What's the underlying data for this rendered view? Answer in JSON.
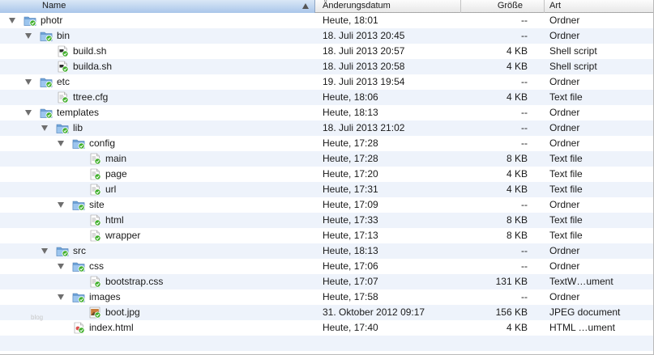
{
  "columns": {
    "name": "Name",
    "date": "Änderungsdatum",
    "size": "Größe",
    "kind": "Art"
  },
  "watermark": "blog",
  "rows": [
    {
      "name": "photr",
      "date": "Heute, 18:01",
      "size": "--",
      "kind": "Ordner",
      "type": "folder",
      "depth": 0,
      "icon": "folder-icon"
    },
    {
      "name": "bin",
      "date": "18. Juli 2013 20:45",
      "size": "--",
      "kind": "Ordner",
      "type": "folder",
      "depth": 1,
      "icon": "folder-icon"
    },
    {
      "name": "build.sh",
      "date": "18. Juli 2013 20:57",
      "size": "4 KB",
      "kind": "Shell script",
      "type": "script",
      "depth": 2,
      "icon": "shell-script-icon"
    },
    {
      "name": "builda.sh",
      "date": "18. Juli 2013 20:58",
      "size": "4 KB",
      "kind": "Shell script",
      "type": "script",
      "depth": 2,
      "icon": "shell-script-icon"
    },
    {
      "name": "etc",
      "date": "19. Juli 2013 19:54",
      "size": "--",
      "kind": "Ordner",
      "type": "folder",
      "depth": 1,
      "icon": "folder-icon"
    },
    {
      "name": "ttree.cfg",
      "date": "Heute, 18:06",
      "size": "4 KB",
      "kind": "Text file",
      "type": "text",
      "depth": 2,
      "icon": "text-file-icon"
    },
    {
      "name": "templates",
      "date": "Heute, 18:13",
      "size": "--",
      "kind": "Ordner",
      "type": "folder",
      "depth": 1,
      "icon": "folder-icon"
    },
    {
      "name": "lib",
      "date": "18. Juli 2013 21:02",
      "size": "--",
      "kind": "Ordner",
      "type": "folder",
      "depth": 2,
      "icon": "folder-icon"
    },
    {
      "name": "config",
      "date": "Heute, 17:28",
      "size": "--",
      "kind": "Ordner",
      "type": "folder",
      "depth": 3,
      "icon": "folder-icon"
    },
    {
      "name": "main",
      "date": "Heute, 17:28",
      "size": "8 KB",
      "kind": "Text file",
      "type": "text",
      "depth": 4,
      "icon": "text-file-icon"
    },
    {
      "name": "page",
      "date": "Heute, 17:20",
      "size": "4 KB",
      "kind": "Text file",
      "type": "text",
      "depth": 4,
      "icon": "text-file-icon"
    },
    {
      "name": "url",
      "date": "Heute, 17:31",
      "size": "4 KB",
      "kind": "Text file",
      "type": "text",
      "depth": 4,
      "icon": "text-file-icon"
    },
    {
      "name": "site",
      "date": "Heute, 17:09",
      "size": "--",
      "kind": "Ordner",
      "type": "folder",
      "depth": 3,
      "icon": "folder-icon"
    },
    {
      "name": "html",
      "date": "Heute, 17:33",
      "size": "8 KB",
      "kind": "Text file",
      "type": "text",
      "depth": 4,
      "icon": "text-file-icon"
    },
    {
      "name": "wrapper",
      "date": "Heute, 17:13",
      "size": "8 KB",
      "kind": "Text file",
      "type": "text",
      "depth": 4,
      "icon": "text-file-icon"
    },
    {
      "name": "src",
      "date": "Heute, 18:13",
      "size": "--",
      "kind": "Ordner",
      "type": "folder",
      "depth": 2,
      "icon": "folder-icon"
    },
    {
      "name": "css",
      "date": "Heute, 17:06",
      "size": "--",
      "kind": "Ordner",
      "type": "folder",
      "depth": 3,
      "icon": "folder-icon"
    },
    {
      "name": "bootstrap.css",
      "date": "Heute, 17:07",
      "size": "131 KB",
      "kind": "TextW…ument",
      "type": "text",
      "depth": 4,
      "icon": "text-file-icon"
    },
    {
      "name": "images",
      "date": "Heute, 17:58",
      "size": "--",
      "kind": "Ordner",
      "type": "folder",
      "depth": 3,
      "icon": "folder-icon"
    },
    {
      "name": "boot.jpg",
      "date": "31. Oktober 2012 09:17",
      "size": "156 KB",
      "kind": "JPEG document",
      "type": "image",
      "depth": 4,
      "icon": "jpeg-image-icon"
    },
    {
      "name": "index.html",
      "date": "Heute, 17:40",
      "size": "4 KB",
      "kind": "HTML …ument",
      "type": "html",
      "depth": 3,
      "icon": "html-file-icon"
    }
  ],
  "colors": {
    "row_stripe": "#eef3fb",
    "header_selected": "#a9c6ea",
    "folder_blue": "#7fb0e0",
    "badge_green": "#3fae2a"
  }
}
